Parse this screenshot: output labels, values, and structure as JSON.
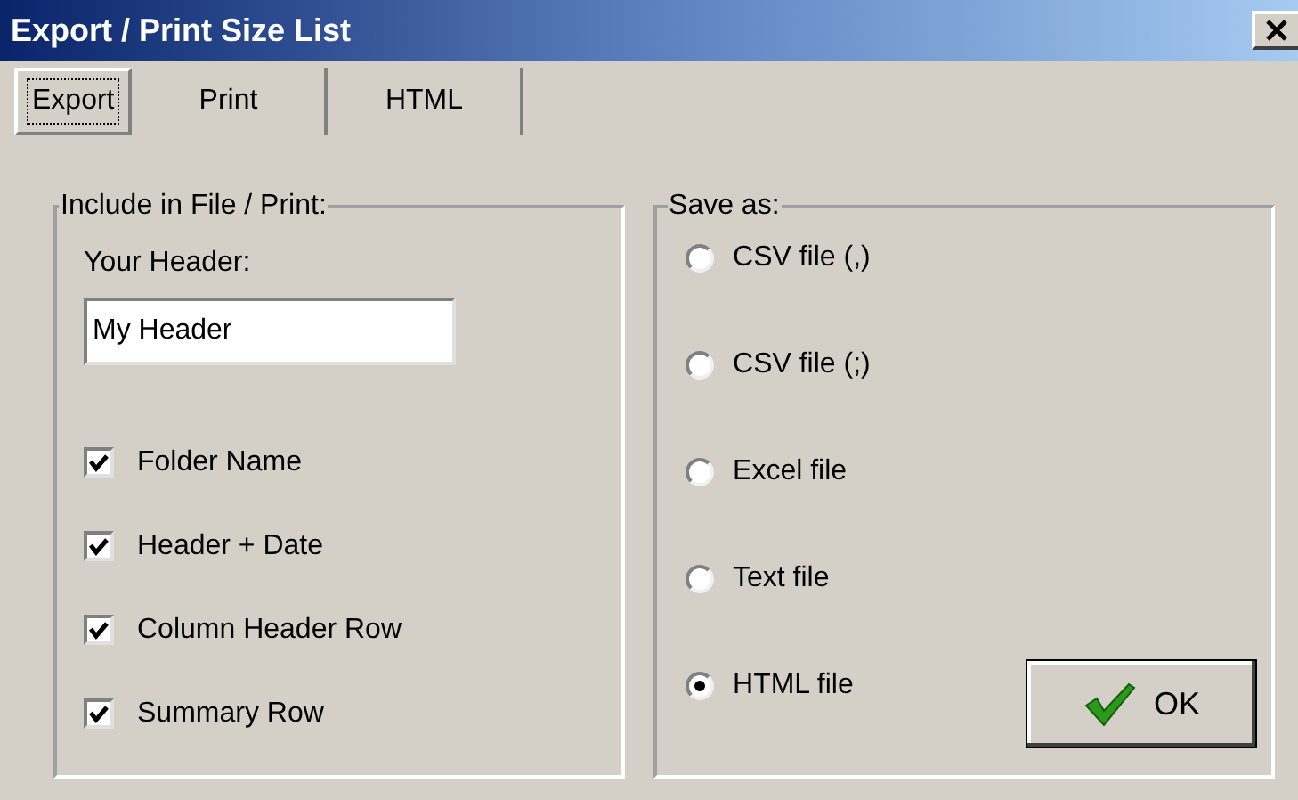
{
  "window": {
    "title": "Export / Print Size List"
  },
  "tabs": [
    {
      "label": "Export",
      "selected": true
    },
    {
      "label": "Print",
      "selected": false
    },
    {
      "label": "HTML",
      "selected": false
    }
  ],
  "include_group": {
    "legend": "Include in File / Print:",
    "header_label": "Your Header:",
    "header_value": "My Header",
    "options": [
      {
        "label": "Folder Name",
        "checked": true
      },
      {
        "label": "Header + Date",
        "checked": true
      },
      {
        "label": "Column Header Row",
        "checked": true
      },
      {
        "label": "Summary Row",
        "checked": true
      }
    ]
  },
  "save_group": {
    "legend": "Save as:",
    "formats": [
      {
        "label": "CSV file (,)",
        "selected": false
      },
      {
        "label": "CSV file (;)",
        "selected": false
      },
      {
        "label": "Excel file",
        "selected": false
      },
      {
        "label": "Text file",
        "selected": false
      },
      {
        "label": "HTML file",
        "selected": true
      }
    ]
  },
  "ok_button": "OK"
}
